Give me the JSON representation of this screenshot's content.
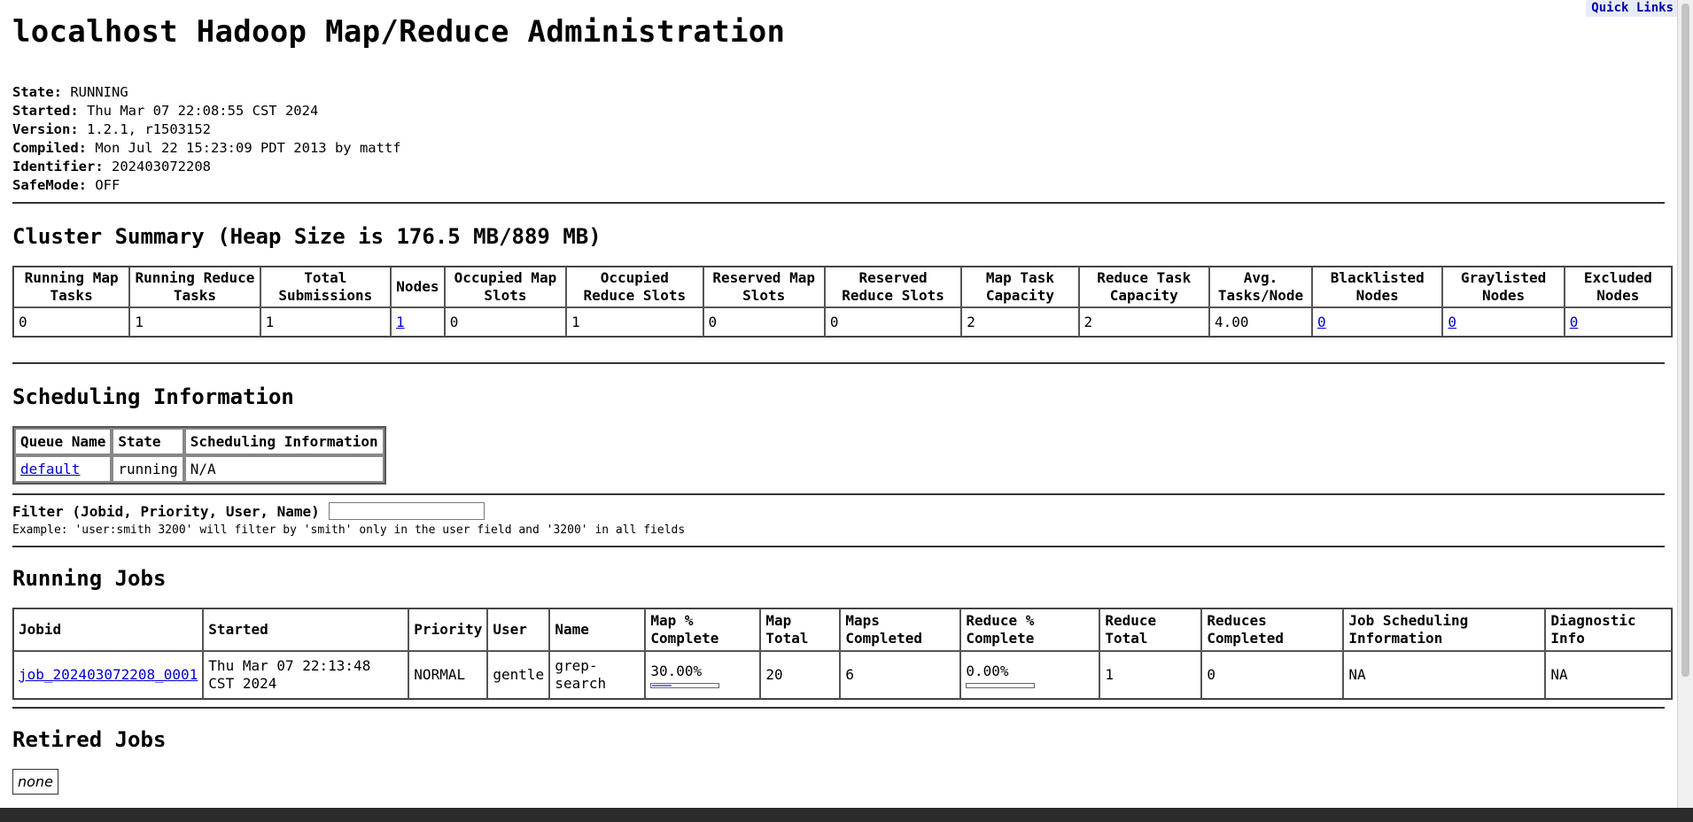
{
  "quick_links": "Quick Links",
  "title": "localhost Hadoop Map/Reduce Administration",
  "info": [
    {
      "label": "State:",
      "value": "RUNNING"
    },
    {
      "label": "Started:",
      "value": "Thu Mar 07 22:08:55 CST 2024"
    },
    {
      "label": "Version:",
      "value": "1.2.1, r1503152"
    },
    {
      "label": "Compiled:",
      "value": "Mon Jul 22 15:23:09 PDT 2013 by mattf"
    },
    {
      "label": "Identifier:",
      "value": "202403072208"
    },
    {
      "label": "SafeMode:",
      "value": "OFF"
    }
  ],
  "cluster_summary": {
    "heading": "Cluster Summary (Heap Size is 176.5 MB/889 MB)",
    "headers": [
      "Running Map Tasks",
      "Running Reduce Tasks",
      "Total Submissions",
      "Nodes",
      "Occupied Map Slots",
      "Occupied Reduce Slots",
      "Reserved Map Slots",
      "Reserved Reduce Slots",
      "Map Task Capacity",
      "Reduce Task Capacity",
      "Avg. Tasks/Node",
      "Blacklisted Nodes",
      "Graylisted Nodes",
      "Excluded Nodes"
    ],
    "values": [
      "0",
      "1",
      "1",
      "1",
      "0",
      "1",
      "0",
      "0",
      "2",
      "2",
      "4.00",
      "0",
      "0",
      "0"
    ]
  },
  "scheduling": {
    "heading": "Scheduling Information",
    "headers": [
      "Queue Name",
      "State",
      "Scheduling Information"
    ],
    "row": [
      "default",
      "running",
      "N/A"
    ]
  },
  "filter": {
    "label": "Filter (Jobid, Priority, User, Name)",
    "value": "",
    "example": "Example: 'user:smith 3200' will filter by 'smith' only in the user field and '3200' in all fields"
  },
  "running_jobs": {
    "heading": "Running Jobs",
    "headers": [
      "Jobid",
      "Started",
      "Priority",
      "User",
      "Name",
      "Map % Complete",
      "Map Total",
      "Maps Completed",
      "Reduce % Complete",
      "Reduce Total",
      "Reduces Completed",
      "Job Scheduling Information",
      "Diagnostic Info"
    ],
    "rows": [
      {
        "jobid": "job_202403072208_0001",
        "started": "Thu Mar 07 22:13:48 CST 2024",
        "priority": "NORMAL",
        "user": "gentle",
        "name": "grep-search",
        "map_pct": "30.00%",
        "map_progress": 0.3,
        "map_total": "20",
        "maps_completed": "6",
        "reduce_pct": "0.00%",
        "reduce_progress": 0.0,
        "reduce_total": "1",
        "reduces_completed": "0",
        "sched_info": "NA",
        "diag_info": "NA"
      }
    ]
  },
  "retired_jobs": {
    "heading": "Retired Jobs",
    "none_label": "none"
  }
}
